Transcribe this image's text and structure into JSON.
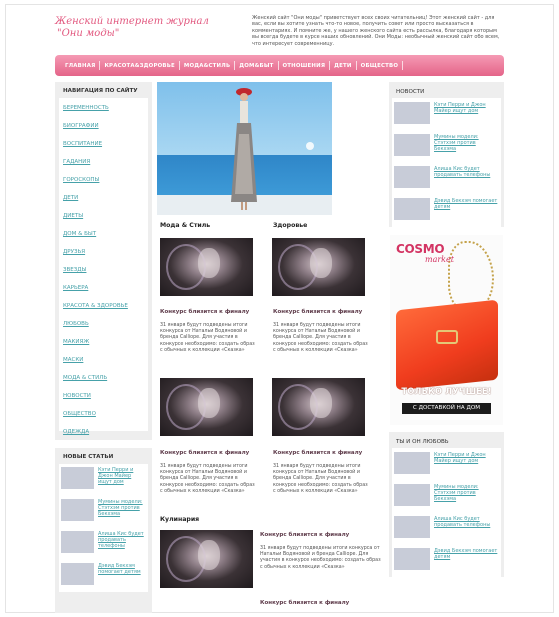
{
  "header": {
    "logo_line1": "Женский интернет журнал",
    "logo_line2": "\"Они моды\"",
    "intro": "Женский сайт \"Они моды\" приветствует всех своих читательниц! Этот женский сайт - для вас, если вы хотите узнать что-то новое, получить совет или просто высказаться в комментариях. И помните же, у нашего женского сайта есть рассылка, благодаря которым вы всегда будете в курсе наших обновлений. Они Моды: необычный женский сайт обо всем, что интересует современницу."
  },
  "nav": {
    "items": [
      "ГЛАВНАЯ",
      "КРАСОТА&ЗДОРОВЬЕ",
      "МОДА&СТИЛЬ",
      "ДОМ&БЫТ",
      "ОТНОШЕНИЯ",
      "ДЕТИ",
      "ОБЩЕСТВО"
    ]
  },
  "sidebar": {
    "nav_title": "НАВИГАЦИЯ ПО САЙТУ",
    "links": [
      "БЕРЕМЕННОСТЬ",
      "БИОГРАФИИ",
      "ВОСПИТАНИЕ",
      "ГАДАНИЯ",
      "ГОРОСКОПЫ",
      "ДЕТИ",
      "ДИЕТЫ",
      "ДОМ & БЫТ",
      "ДРУЗЬЯ",
      "ЗВЕЗДЫ",
      "КАРЬЕРА",
      "КРАСОТА & ЗДОРОВЬЕ",
      "ЛЮБОВЬ",
      "МАКИЯЖ",
      "МАСКИ",
      "МОДА & СТИЛЬ",
      "НОВОСТИ",
      "ОБЩЕСТВО",
      "ОДЕЖДА"
    ],
    "new_title": "НОВЫЕ СТАТЬИ",
    "new_items": [
      "Кэти Перри и Джон Майер ищут дом",
      "Мумины модели: Стэтхэм против Бекхэма",
      "Алиша Кис будет продавать телефоны",
      "Дэвид Бекхэм помогает детям"
    ]
  },
  "main": {
    "sec_fashion": "Мода & Стиль",
    "sec_health": "Здоровье",
    "sec_cooking": "Кулинария",
    "article_title": "Конкурс близится к финалу",
    "article_text": "31 января будут подведены итоги конкурса от Натальи Водяновой и бренда Calliope. Для участия в конкурсе необходимо: создать образ с обычных к коллекции «Сказка»"
  },
  "right": {
    "news_title": "НОВОСТИ",
    "news_items": [
      "Кэти Перри и Джон Майер ищут дом",
      "Мумины модели: Стэтхэм против Бекхэма",
      "Алиша Кис будет продавать телефоны",
      "Дэвид Бекхэм помогает детям"
    ],
    "love_title": "ТЫ И ОН ЛЮБОВЬ",
    "love_items": [
      "Кэти Перри и Джон Майер ищут дом",
      "Мумины модели: Стэтхэм против Бекхэма",
      "Алиша Кис будет продавать телефоны",
      "Дэвид Бекхэм помогает детям"
    ]
  },
  "ad": {
    "brand": "COSMO",
    "brand_sub": "market",
    "slogan": "ТОЛЬКО ЛУЧШЕЕ!",
    "delivery": "С ДОСТАВКОЙ НА ДОМ"
  },
  "colors": {
    "accent_pink": "#e46489",
    "link_teal": "#46a1a9",
    "logo_pink": "#e2587f"
  }
}
